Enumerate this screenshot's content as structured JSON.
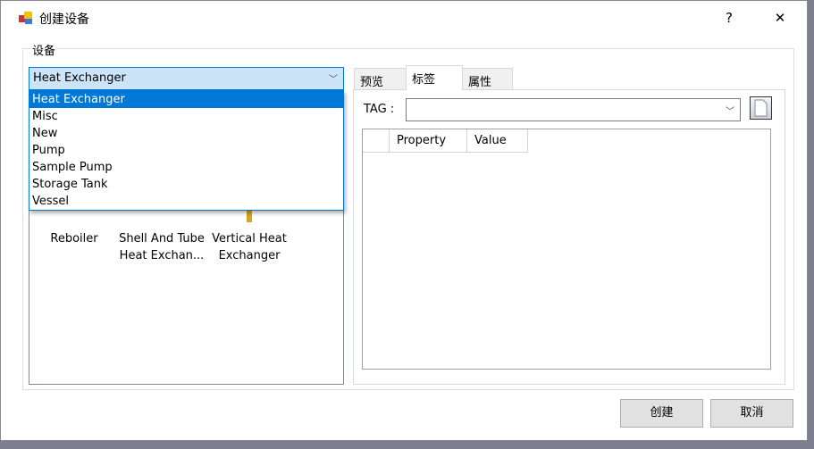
{
  "window": {
    "title": "创建设备",
    "help": "?",
    "close": "✕"
  },
  "group": {
    "label": "设备"
  },
  "category_combo": {
    "value": "Heat Exchanger",
    "options": [
      "Heat Exchanger",
      "Misc",
      "New",
      "Pump",
      "Sample Pump",
      "Storage Tank",
      "Vessel"
    ],
    "selected_index": 0
  },
  "items": [
    {
      "label": "Reboiler"
    },
    {
      "label": "Shell And Tube Heat Exchan..."
    },
    {
      "label": "Vertical Heat Exchanger"
    }
  ],
  "tabs": [
    {
      "label": "预览"
    },
    {
      "label": "标签",
      "active": true
    },
    {
      "label": "属性"
    }
  ],
  "tag": {
    "label": "TAG :",
    "value": ""
  },
  "grid": {
    "columns": [
      "",
      "Property",
      "Value"
    ]
  },
  "buttons": {
    "create": "创建",
    "cancel": "取消"
  },
  "colors": {
    "accent": "#0078d7",
    "combo_bg": "#cce4f7"
  }
}
